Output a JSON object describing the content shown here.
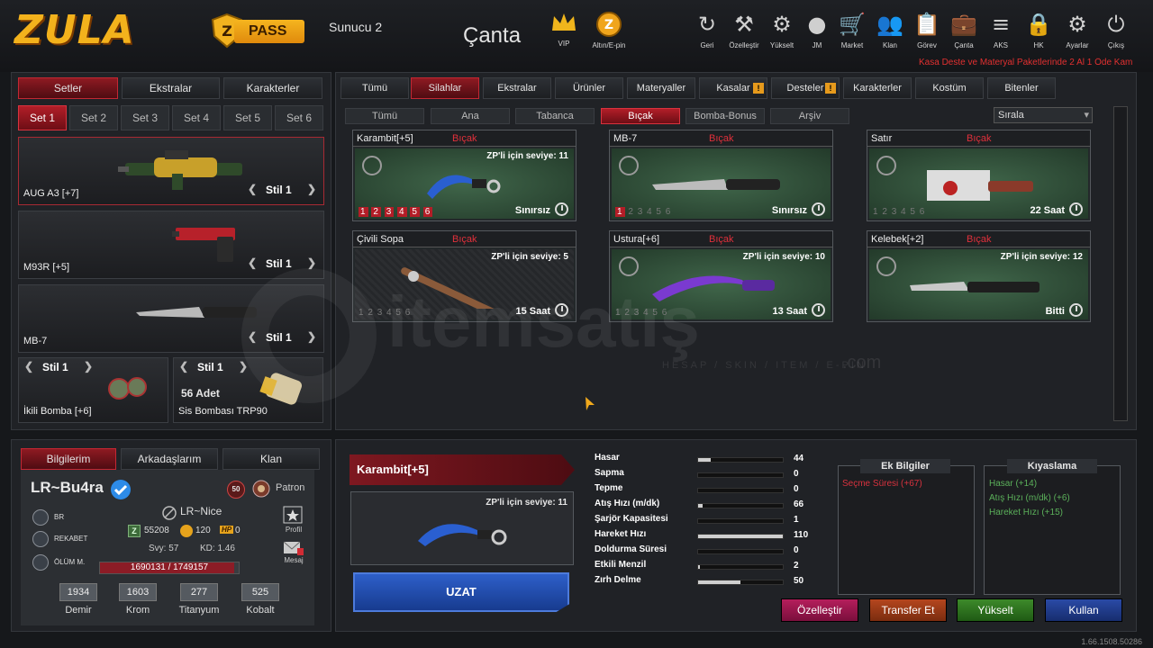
{
  "header": {
    "logo": "ZULA",
    "pass": "PASS",
    "server": "Sunucu 2",
    "title": "Çanta",
    "vip": "VIP",
    "gold": "Altın/E-pin",
    "nav": [
      {
        "label": "Geri",
        "icon": "back-icon"
      },
      {
        "label": "Özelleştir",
        "icon": "tools-icon"
      },
      {
        "label": "Yükselt",
        "icon": "upgrade-icon"
      },
      {
        "label": "JM",
        "icon": "jm-icon"
      },
      {
        "label": "Market",
        "icon": "cart-icon"
      },
      {
        "label": "Klan",
        "icon": "clan-icon"
      },
      {
        "label": "Görev",
        "icon": "task-icon"
      },
      {
        "label": "Çanta",
        "icon": "bag-icon"
      },
      {
        "label": "AKS",
        "icon": "aks-icon"
      },
      {
        "label": "HK",
        "icon": "lock-icon"
      },
      {
        "label": "Ayarlar",
        "icon": "gear-icon"
      },
      {
        "label": "Çıkış",
        "icon": "power-icon"
      }
    ],
    "ticker": "Kasa Deste ve Materyal Paketlerinde 2 Al 1 Öde Kam"
  },
  "left": {
    "tabs": [
      "Setler",
      "Ekstralar",
      "Karakterler"
    ],
    "sets": [
      "Set 1",
      "Set 2",
      "Set 3",
      "Set 4",
      "Set 5",
      "Set 6"
    ],
    "slots": [
      {
        "name": "AUG A3 [+7]",
        "style": "Stil 1"
      },
      {
        "name": "M93R [+5]",
        "style": "Stil 1"
      },
      {
        "name": "MB-7",
        "style": "Stil 1"
      }
    ],
    "grenades": [
      {
        "name": "İkili Bomba [+6]",
        "style": "Stil 1",
        "count": ""
      },
      {
        "name": "Sis Bombası TRP90",
        "style": "Stil 1",
        "count": "56 Adet"
      }
    ]
  },
  "profile": {
    "tabs": [
      "Bilgilerim",
      "Arkadaşlarım",
      "Klan"
    ],
    "name": "LR~Bu4ra",
    "badge": "50",
    "title": "Patron",
    "clan": "LR~Nice",
    "zp": "55208",
    "gold": "120",
    "hp_label": "HP",
    "hp": "0",
    "level": "Svy: 57",
    "kd": "KD: 1.46",
    "ranks": [
      "BR",
      "REKABET",
      "ÖLÜM M."
    ],
    "xp": "1690131 / 1749157",
    "xp_fraction": 0.966,
    "profile_label": "Profil",
    "mail_label": "Mesaj",
    "resources": [
      {
        "v": "1934",
        "l": "Demir"
      },
      {
        "v": "1603",
        "l": "Krom"
      },
      {
        "v": "277",
        "l": "Titanyum"
      },
      {
        "v": "525",
        "l": "Kobalt"
      }
    ]
  },
  "inventory": {
    "tabs": [
      "Tümü",
      "Silahlar",
      "Ekstralar",
      "Ürünler",
      "Materyaller",
      "Kasalar",
      "Desteler",
      "Karakterler",
      "Kostüm",
      "Bitenler"
    ],
    "subtabs": [
      "Tümü",
      "Ana",
      "Tabanca",
      "Bıçak",
      "Bomba-Bonus",
      "Arşiv"
    ],
    "sort": "Sırala",
    "items": [
      {
        "name": "Karambit[+5]",
        "cat": "Bıçak",
        "lvl": "ZP'li için seviye: 11",
        "dur": "Sınırsız",
        "nums": [
          "1",
          "2",
          "3",
          "4",
          "5",
          "6"
        ],
        "on": [
          1,
          2,
          3,
          4,
          5,
          6
        ]
      },
      {
        "name": "MB-7",
        "cat": "Bıçak",
        "lvl": "",
        "dur": "Sınırsız",
        "nums": [
          "1",
          "2",
          "3",
          "4",
          "5",
          "6"
        ],
        "on": [
          1
        ]
      },
      {
        "name": "Satır",
        "cat": "Bıçak",
        "lvl": "",
        "dur": "22 Saat",
        "nums": [
          "1",
          "2",
          "3",
          "4",
          "5",
          "6"
        ],
        "on": []
      },
      {
        "name": "Çivili Sopa",
        "cat": "Bıçak",
        "lvl": "ZP'li için seviye: 5",
        "dur": "15 Saat",
        "nums": [
          "1",
          "2",
          "3",
          "4",
          "5",
          "6"
        ],
        "on": []
      },
      {
        "name": "Ustura[+6]",
        "cat": "Bıçak",
        "lvl": "ZP'li için seviye: 10",
        "dur": "13 Saat",
        "nums": [
          "1",
          "2",
          "3",
          "4",
          "5",
          "6"
        ],
        "on": []
      },
      {
        "name": "Kelebek[+2]",
        "cat": "Bıçak",
        "lvl": "ZP'li için seviye: 12",
        "dur": "Bitti",
        "nums": [],
        "on": []
      }
    ]
  },
  "detail": {
    "name": "Karambit[+5]",
    "lvl": "ZP'li için seviye: 11",
    "extend": "UZAT",
    "stats": [
      {
        "l": "Hasar",
        "v": "44",
        "f": 0.15
      },
      {
        "l": "Sapma",
        "v": "0",
        "f": 0
      },
      {
        "l": "Tepme",
        "v": "0",
        "f": 0
      },
      {
        "l": "Atış Hızı (m/dk)",
        "v": "66",
        "f": 0.05
      },
      {
        "l": "Şarjör Kapasitesi",
        "v": "1",
        "f": 0
      },
      {
        "l": "Hareket Hızı",
        "v": "110",
        "f": 1
      },
      {
        "l": "Doldurma Süresi",
        "v": "0",
        "f": 0
      },
      {
        "l": "Etkili Menzil",
        "v": "2",
        "f": 0.02
      },
      {
        "l": "Zırh Delme",
        "v": "50",
        "f": 0.5
      }
    ],
    "extra_title": "Ek Bilgiler",
    "extra": [
      "Seçme Süresi (+67)"
    ],
    "compare_title": "Kıyaslama",
    "compare": [
      "Hasar (+14)",
      "Atış Hızı (m/dk) (+6)",
      "Hareket Hızı (+15)"
    ],
    "actions": [
      "Özelleştir",
      "Transfer Et",
      "Yükselt",
      "Kullan"
    ]
  },
  "watermark": {
    "brand": "itemsatış",
    "tagline": "HESAP / SKIN / ITEM / E-PIN",
    "com": ".com"
  },
  "version": "1.66.1508.50286"
}
